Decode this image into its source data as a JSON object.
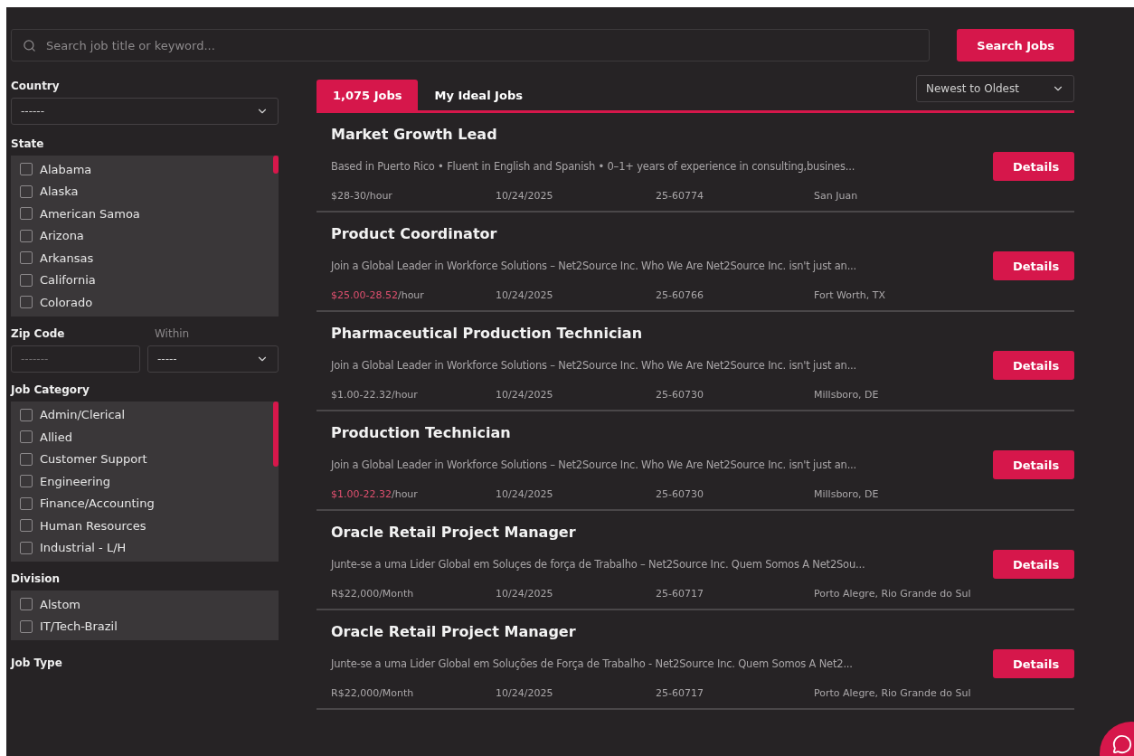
{
  "search": {
    "placeholder": "Search job title or keyword...",
    "button": "Search Jobs"
  },
  "filters": {
    "country": {
      "label": "Country",
      "value": "------"
    },
    "state": {
      "label": "State",
      "items": [
        {
          "label": "Alabama",
          "checked": false
        },
        {
          "label": "Alaska",
          "checked": false
        },
        {
          "label": "American Samoa",
          "checked": false
        },
        {
          "label": "Arizona",
          "checked": false
        },
        {
          "label": "Arkansas",
          "checked": false
        },
        {
          "label": "California",
          "checked": false
        },
        {
          "label": "Colorado",
          "checked": false
        }
      ]
    },
    "zip": {
      "label": "Zip Code",
      "placeholder": "-------"
    },
    "within": {
      "label": "Within",
      "value": "-----"
    },
    "category": {
      "label": "Job Category",
      "items": [
        {
          "label": "Admin/Clerical",
          "checked": false
        },
        {
          "label": "Allied",
          "checked": false
        },
        {
          "label": "Customer Support",
          "checked": false
        },
        {
          "label": "Engineering",
          "checked": false
        },
        {
          "label": "Finance/Accounting",
          "checked": false
        },
        {
          "label": "Human Resources",
          "checked": false
        },
        {
          "label": "Industrial - L/H",
          "checked": false
        }
      ]
    },
    "division": {
      "label": "Division",
      "items": [
        {
          "label": "Alstom",
          "checked": false
        },
        {
          "label": "IT/Tech-Brazil",
          "checked": false
        }
      ]
    },
    "job_type": {
      "label": "Job Type"
    }
  },
  "tabs": [
    {
      "label": "1,075 Jobs",
      "selected": true
    },
    {
      "label": "My Ideal Jobs",
      "selected": false
    }
  ],
  "sort": {
    "value": "Newest to Oldest"
  },
  "jobs": [
    {
      "title": "Market Growth Lead",
      "description": "Based in Puerto Rico • Fluent in English and Spanish • 0–1+  years of experience in consulting,busines...",
      "pay": {
        "amount": "$28-30",
        "unit": "/hour",
        "highlighted": false
      },
      "date": "10/24/2025",
      "id": "25-60774",
      "location": "San Juan",
      "button": "Details"
    },
    {
      "title": "Product Coordinator",
      "description": "Join a Global Leader in Workforce Solutions – Net2Source Inc. Who We Are Net2Source Inc. isn't just an...",
      "pay": {
        "amount": "$25.00-28.52",
        "unit": "/hour",
        "highlighted": true
      },
      "date": "10/24/2025",
      "id": "25-60766",
      "location": "Fort Worth, TX",
      "button": "Details"
    },
    {
      "title": "Pharmaceutical Production Technician",
      "description": "Join a Global Leader in Workforce Solutions – Net2Source Inc. Who We Are Net2Source Inc. isn't just an...",
      "pay": {
        "amount": "$1.00-22.32",
        "unit": "/hour",
        "highlighted": false
      },
      "date": "10/24/2025",
      "id": "25-60730",
      "location": "Millsboro, DE",
      "button": "Details"
    },
    {
      "title": "Production Technician",
      "description": "Join a Global Leader in Workforce Solutions – Net2Source Inc. Who We Are Net2Source Inc. isn't just an...",
      "pay": {
        "amount": "$1.00-22.32",
        "unit": "/hour",
        "highlighted": true
      },
      "date": "10/24/2025",
      "id": "25-60730",
      "location": "Millsboro, DE",
      "button": "Details"
    },
    {
      "title": "Oracle Retail Project Manager",
      "description": "Junte-se a uma Lider Global em Soluçes de força de Trabalho – Net2Source Inc. Quem Somos A Net2Sou...",
      "pay": {
        "amount": "R$22,000",
        "unit": "/Month",
        "highlighted": false
      },
      "date": "10/24/2025",
      "id": "25-60717",
      "location": "Porto Alegre, Rio Grande do Sul",
      "button": "Details"
    },
    {
      "title": "Oracle Retail Project Manager",
      "description": "Junte-se a uma Lider Global em Soluções de Força de Trabalho - Net2Source Inc. Quem Somos A Net2...",
      "pay": {
        "amount": "R$22,000",
        "unit": "/Month",
        "highlighted": false
      },
      "date": "10/24/2025",
      "id": "25-60717",
      "location": "Porto Alegre, Rio Grande do Sul",
      "button": "Details"
    }
  ]
}
